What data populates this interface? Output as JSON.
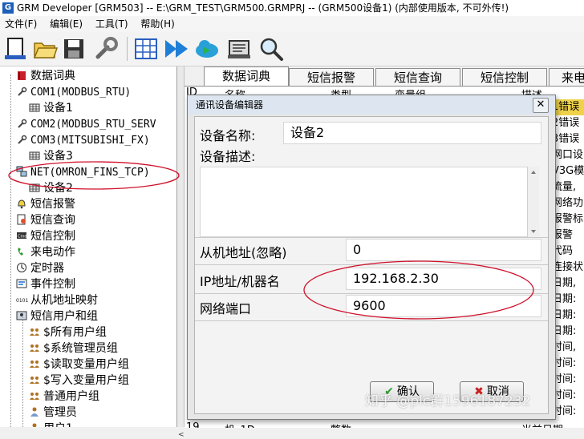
{
  "window": {
    "title": "GRM Developer [GRM503]  -- E:\\GRM_TEST\\GRM500.GRMPRJ -- (GRM500设备1) (内部使用版本, 不可外传!)",
    "app_icon": "G"
  },
  "menu": [
    "文件(F)",
    "编辑(E)",
    "工具(T)",
    "帮助(H)"
  ],
  "toolbar_icons": [
    "new-icon",
    "open-icon",
    "save-icon",
    "wrench-icon",
    "grid-icon",
    "run-icon",
    "cloud-sync-icon",
    "device-icon",
    "search-icon"
  ],
  "tree": [
    {
      "label": "数据词典",
      "icon": "book-icon",
      "mono": false
    },
    {
      "label": "COM1(MODBUS_RTU)",
      "icon": "plug-icon",
      "mono": true
    },
    {
      "label": "设备1",
      "icon": "device-icon",
      "mono": false
    },
    {
      "label": "COM2(MODBUS_RTU_SERV",
      "icon": "plug-icon",
      "mono": true
    },
    {
      "label": "COM3(MITSUBISHI_FX)",
      "icon": "plug-icon",
      "mono": true
    },
    {
      "label": "设备3",
      "icon": "device-icon",
      "mono": false
    },
    {
      "label": "NET(OMRON_FINS_TCP)",
      "icon": "network-icon",
      "mono": true
    },
    {
      "label": "设备2",
      "icon": "device-icon",
      "mono": false
    },
    {
      "label": "短信报警",
      "icon": "bell-icon",
      "mono": false
    },
    {
      "label": "短信查询",
      "icon": "query-icon",
      "mono": false
    },
    {
      "label": "短信控制",
      "icon": "cmd-icon",
      "mono": false
    },
    {
      "label": "来电动作",
      "icon": "phone-icon",
      "mono": false
    },
    {
      "label": "定时器",
      "icon": "clock-icon",
      "mono": false
    },
    {
      "label": "事件控制",
      "icon": "event-icon",
      "mono": false
    },
    {
      "label": "从机地址映射",
      "icon": "binary-icon",
      "mono": false
    },
    {
      "label": "短信用户和组",
      "icon": "users-icon",
      "mono": false
    },
    {
      "label": "$所有用户组",
      "icon": "group-icon",
      "mono": false
    },
    {
      "label": "$系统管理员组",
      "icon": "group-icon",
      "mono": false
    },
    {
      "label": "$读取变量用户组",
      "icon": "group-icon",
      "mono": false
    },
    {
      "label": "$写入变量用户组",
      "icon": "group-icon",
      "mono": false
    },
    {
      "label": "普通用户组",
      "icon": "group-icon",
      "mono": false
    },
    {
      "label": "管理员",
      "icon": "user-icon",
      "mono": false
    },
    {
      "label": "用户1",
      "icon": "user-icon",
      "mono": false
    }
  ],
  "tabs": [
    "数据词典",
    "短信报警",
    "短信查询",
    "短信控制",
    "来电"
  ],
  "grid": {
    "headers": [
      "ID",
      "名称",
      "类型",
      "变量组",
      "描述"
    ],
    "right_column": [
      "1错误",
      "2错误",
      "3错误",
      "网口设",
      "V3G模",
      "流量,",
      "网络功",
      "报警标",
      "报警",
      "代码",
      "连接状",
      "日期,",
      "日期:",
      "日期:",
      "日期:",
      "时间,",
      "时间:",
      "时间:",
      "时间:",
      "时间:"
    ],
    "bottom_row": [
      "19",
      "机_1D",
      "整数",
      "当前日期"
    ]
  },
  "dialog": {
    "title": "通讯设备编辑器",
    "close": "✕",
    "name_label": "设备名称:",
    "name_value": "设备2",
    "desc_label": "设备描述:",
    "desc_value": "",
    "slave_label": "从机地址(忽略)",
    "slave_value": "0",
    "ip_label": "IP地址/机器名",
    "ip_value": "192.168.2.30",
    "port_label": "网络端口",
    "port_value": "9600",
    "ok": "确认",
    "cancel": "取消"
  },
  "watermark": "知乎 @plc群1596187232",
  "highlight_color": "#d0102a"
}
